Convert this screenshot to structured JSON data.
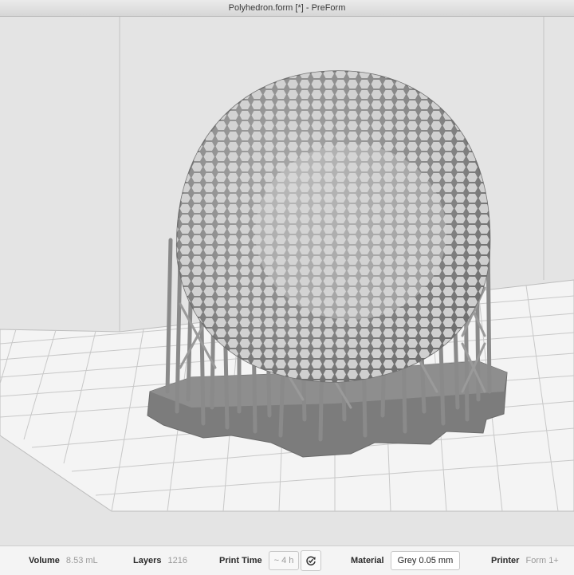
{
  "window": {
    "title": "Polyhedron.form [*] - PreForm"
  },
  "colors": {
    "model": "#8a8a8a",
    "grid_line": "#c4c4c4",
    "platform": "#f6f6f6"
  },
  "statusbar": {
    "volume": {
      "label": "Volume",
      "value": "8.53 mL"
    },
    "layers": {
      "label": "Layers",
      "value": "1216"
    },
    "print_time": {
      "label": "Print Time",
      "value": "~ 4 h",
      "refresh_icon": "refresh-icon"
    },
    "material": {
      "label": "Material",
      "value": "Grey 0.05 mm"
    },
    "printer": {
      "label": "Printer",
      "value": "Form 1+"
    }
  }
}
